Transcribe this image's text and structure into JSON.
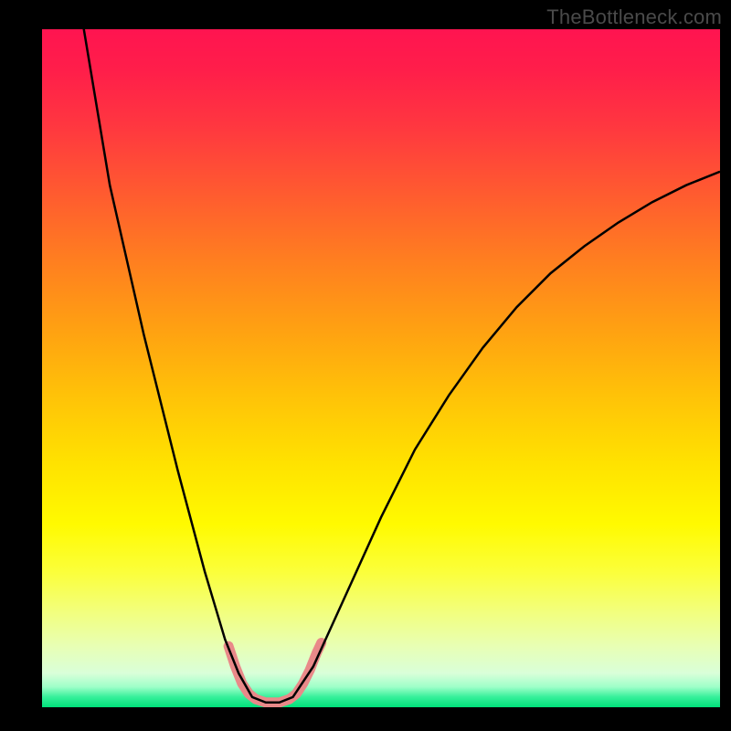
{
  "attribution": "TheBottleneck.com",
  "chart_data": {
    "type": "line",
    "title": "",
    "xlabel": "",
    "ylabel": "",
    "x_range_fraction": [
      0,
      1
    ],
    "y_range_percent": [
      0,
      100
    ],
    "series": [
      {
        "name": "bottleneck-curve",
        "color": "#000000",
        "stroke_width": 2.5,
        "points": [
          {
            "x": 0.055,
            "y": 104
          },
          {
            "x": 0.1,
            "y": 77
          },
          {
            "x": 0.15,
            "y": 55
          },
          {
            "x": 0.2,
            "y": 35
          },
          {
            "x": 0.24,
            "y": 20
          },
          {
            "x": 0.27,
            "y": 10
          },
          {
            "x": 0.29,
            "y": 5
          },
          {
            "x": 0.31,
            "y": 1.5
          },
          {
            "x": 0.33,
            "y": 0.7
          },
          {
            "x": 0.35,
            "y": 0.7
          },
          {
            "x": 0.37,
            "y": 1.5
          },
          {
            "x": 0.4,
            "y": 6
          },
          {
            "x": 0.45,
            "y": 17
          },
          {
            "x": 0.5,
            "y": 28
          },
          {
            "x": 0.55,
            "y": 38
          },
          {
            "x": 0.6,
            "y": 46
          },
          {
            "x": 0.65,
            "y": 53
          },
          {
            "x": 0.7,
            "y": 59
          },
          {
            "x": 0.75,
            "y": 64
          },
          {
            "x": 0.8,
            "y": 68
          },
          {
            "x": 0.85,
            "y": 71.5
          },
          {
            "x": 0.9,
            "y": 74.5
          },
          {
            "x": 0.95,
            "y": 77
          },
          {
            "x": 1.0,
            "y": 79
          }
        ]
      },
      {
        "name": "valley-highlight",
        "color": "#e98989",
        "stroke_width": 11,
        "linecap": "round",
        "points": [
          {
            "x": 0.275,
            "y": 9
          },
          {
            "x": 0.285,
            "y": 6
          },
          {
            "x": 0.295,
            "y": 3.5
          },
          {
            "x": 0.305,
            "y": 2
          },
          {
            "x": 0.315,
            "y": 1.2
          },
          {
            "x": 0.33,
            "y": 0.7
          },
          {
            "x": 0.35,
            "y": 0.7
          },
          {
            "x": 0.365,
            "y": 1.2
          },
          {
            "x": 0.375,
            "y": 2
          },
          {
            "x": 0.385,
            "y": 3.5
          },
          {
            "x": 0.395,
            "y": 5.5
          },
          {
            "x": 0.405,
            "y": 8
          },
          {
            "x": 0.412,
            "y": 9.5
          }
        ]
      }
    ],
    "gradient_stops": [
      {
        "pos": 0.0,
        "color": "#ff1450"
      },
      {
        "pos": 0.5,
        "color": "#ffc208"
      },
      {
        "pos": 0.8,
        "color": "#fbff3a"
      },
      {
        "pos": 1.0,
        "color": "#00e07a"
      }
    ]
  }
}
